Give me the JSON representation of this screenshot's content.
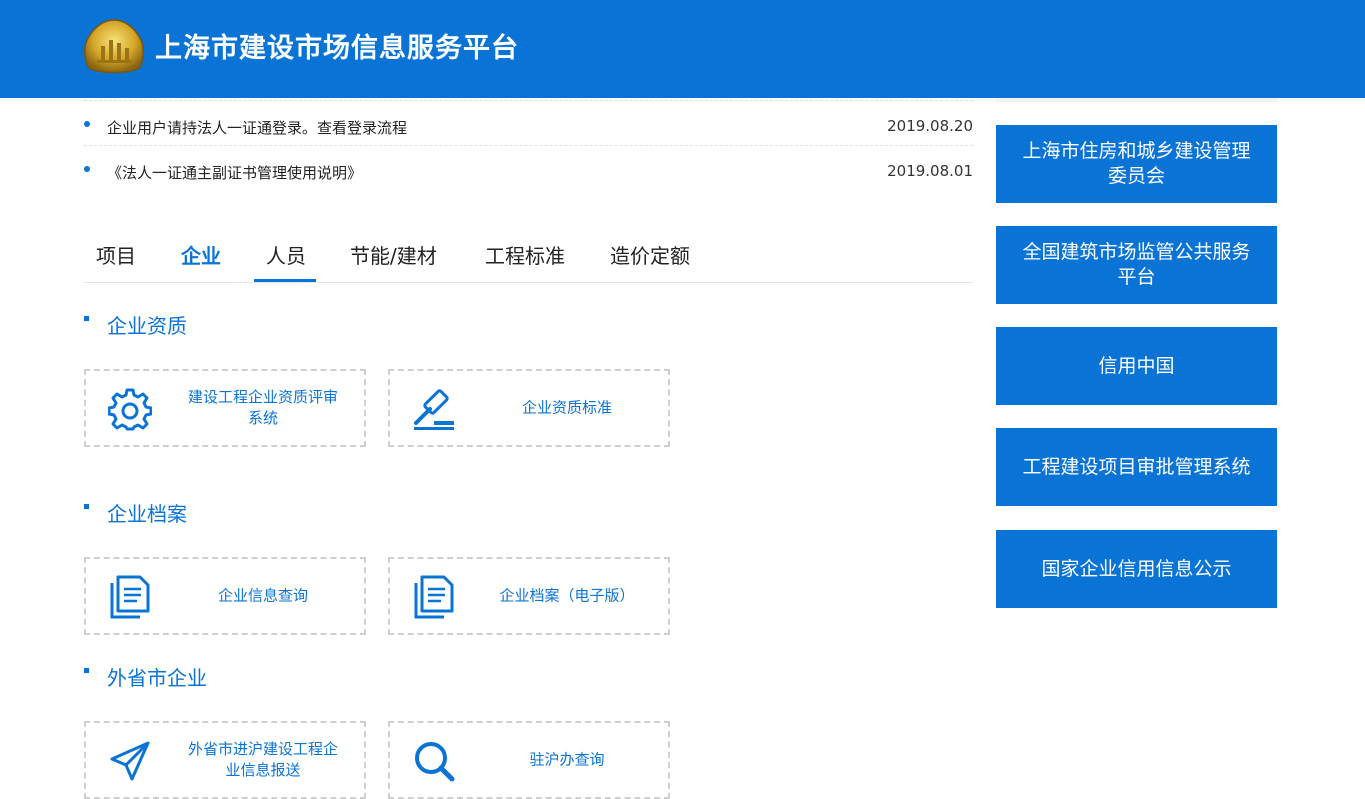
{
  "header": {
    "title": "上海市建设市场信息服务平台",
    "logo_icon": "shanghai-construction-emblem"
  },
  "notices": [
    {
      "text": "企业用户请持法人一证通登录。查看登录流程",
      "date": "2019.08.20"
    },
    {
      "text": "《法人一证通主副证书管理使用说明》",
      "date": "2019.08.01"
    }
  ],
  "tabs": [
    {
      "label": "项目"
    },
    {
      "label": "企业",
      "active": true
    },
    {
      "label": "人员"
    },
    {
      "label": "节能/建材"
    },
    {
      "label": "工程标准"
    },
    {
      "label": "造价定额"
    }
  ],
  "sections": [
    {
      "title": "企业资质",
      "cards": [
        {
          "label": "建设工程企业资质评审系统",
          "icon": "gear-icon"
        },
        {
          "label": "企业资质标准",
          "icon": "gavel-icon"
        }
      ]
    },
    {
      "title": "企业档案",
      "cards": [
        {
          "label": "企业信息查询",
          "icon": "document-icon"
        },
        {
          "label": "企业档案（电子版）",
          "icon": "document-icon"
        }
      ]
    },
    {
      "title": "外省市企业",
      "cards": [
        {
          "label": "外省市进沪建设工程企业信息报送",
          "icon": "send-icon"
        },
        {
          "label": "驻沪办查询",
          "icon": "search-icon"
        }
      ]
    }
  ],
  "side_links": [
    {
      "label": "上海市住房和城乡建设管理委员会"
    },
    {
      "label": "全国建筑市场监管公共服务平台"
    },
    {
      "label": "信用中国"
    },
    {
      "label": "工程建设项目审批管理系统"
    },
    {
      "label": "国家企业信用信息公示"
    }
  ],
  "colors": {
    "brand_blue": "#0a74d6",
    "card_border": "#cfcfcf",
    "text_dark": "#222222"
  }
}
